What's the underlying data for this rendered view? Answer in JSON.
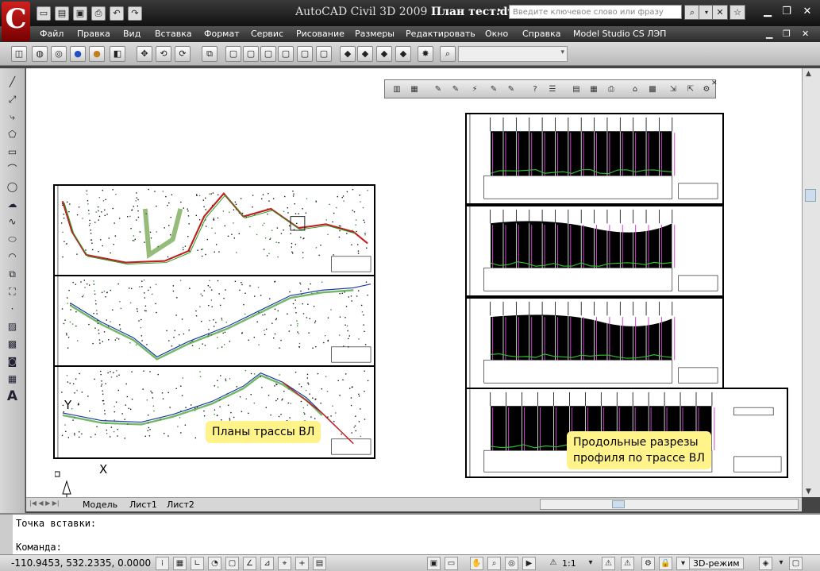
{
  "titlebar": {
    "app_name": "AutoCAD Civil 3D 2009",
    "file_name": "План тест.dwg",
    "search_placeholder": "Введите ключевое слово или фразу",
    "logo_letter": "C"
  },
  "menu": {
    "items": [
      "Файл",
      "Правка",
      "Вид",
      "Вставка",
      "Формат",
      "Сервис",
      "Рисование",
      "Размеры",
      "Редактировать",
      "Окно",
      "Справка",
      "Model Studio CS ЛЭП"
    ]
  },
  "callouts": {
    "plans": "Планы трассы ВЛ",
    "profiles_line1": "Продольные разрезы",
    "profiles_line2": "профиля по трассе ВЛ"
  },
  "ucs": {
    "y_label": "Y",
    "x_label": "X"
  },
  "tabs": [
    "Модель",
    "Лист1",
    "Лист2"
  ],
  "cmdline": {
    "line1": "Точка вставки:",
    "line2": "Команда:"
  },
  "status": {
    "coords": "-110.9453, 532.2335, 0.0000",
    "scale": "1:1",
    "mode": "3D-режим"
  },
  "colors": {
    "accent": "#c41a1a",
    "callout": "#fff38a"
  }
}
